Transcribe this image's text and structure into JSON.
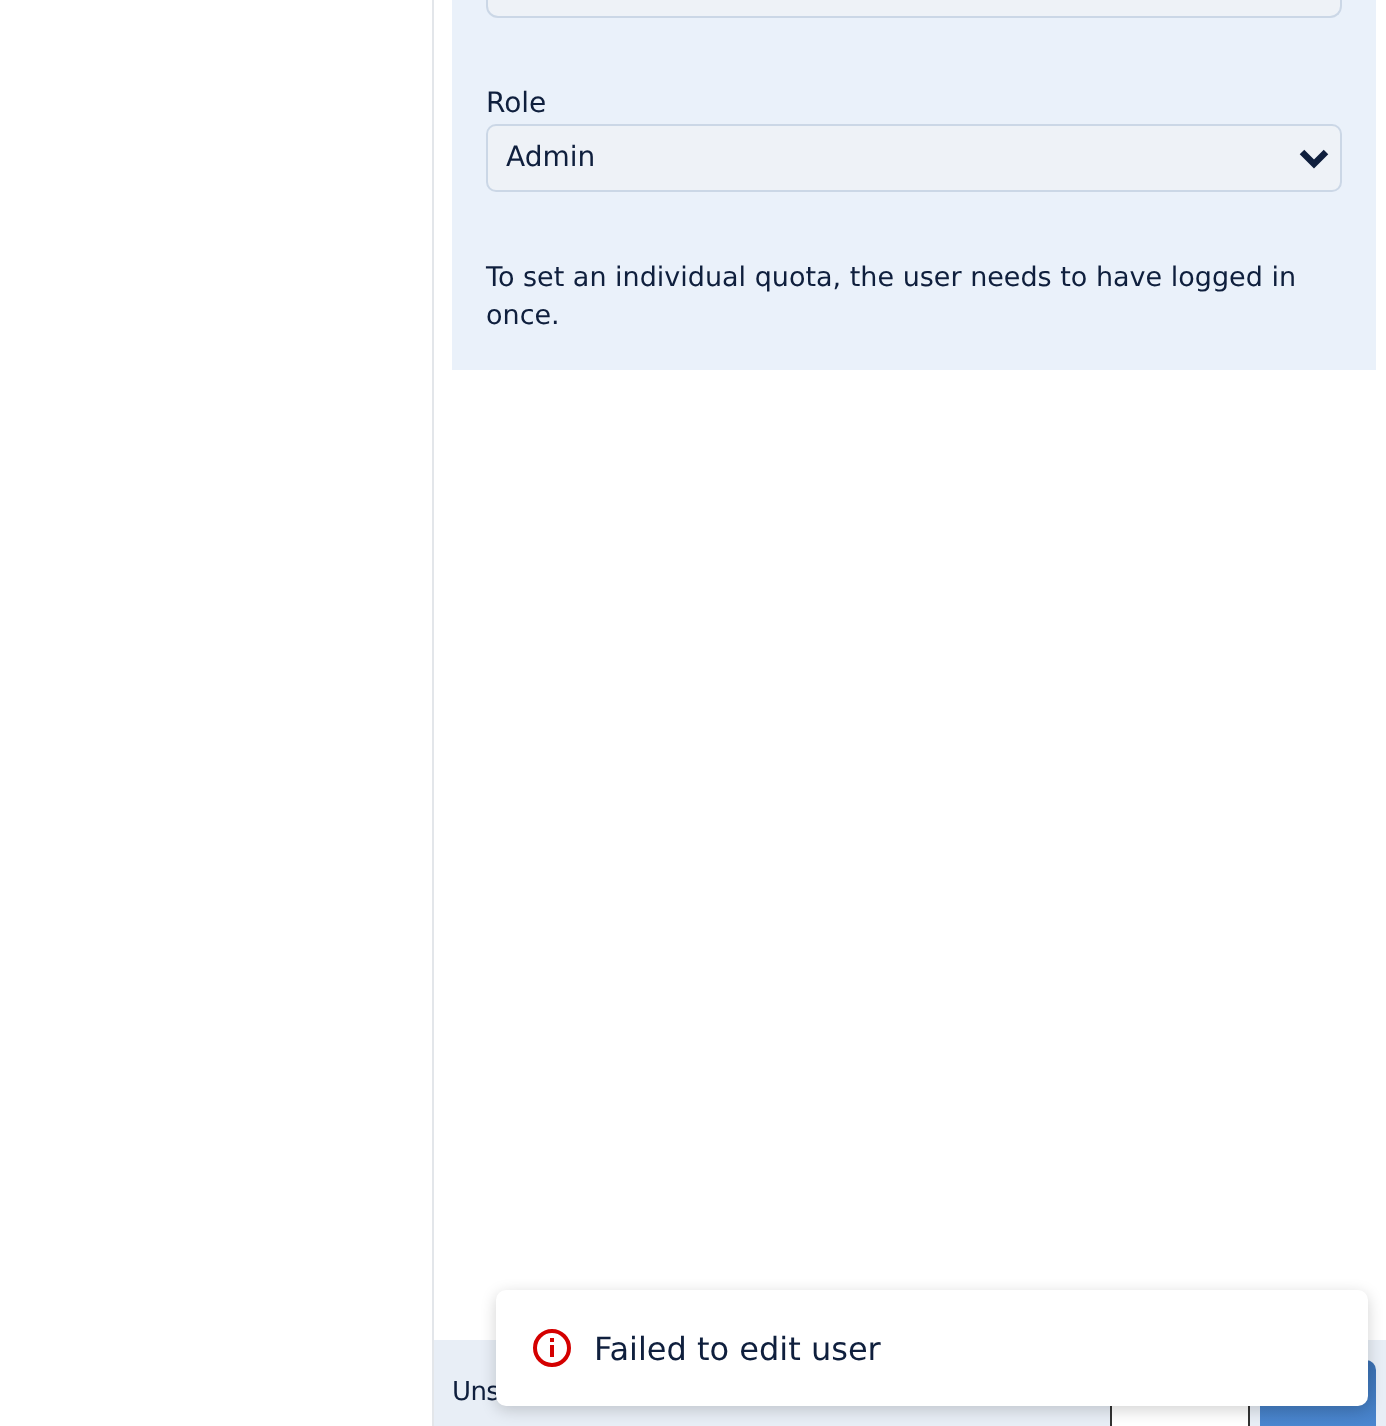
{
  "form": {
    "role": {
      "label": "Role",
      "value": "Admin"
    },
    "note": "To set an individual quota, the user needs to have logged in once."
  },
  "footer": {
    "text": "Uns"
  },
  "toast": {
    "kind": "error",
    "message": "Failed to edit user"
  }
}
